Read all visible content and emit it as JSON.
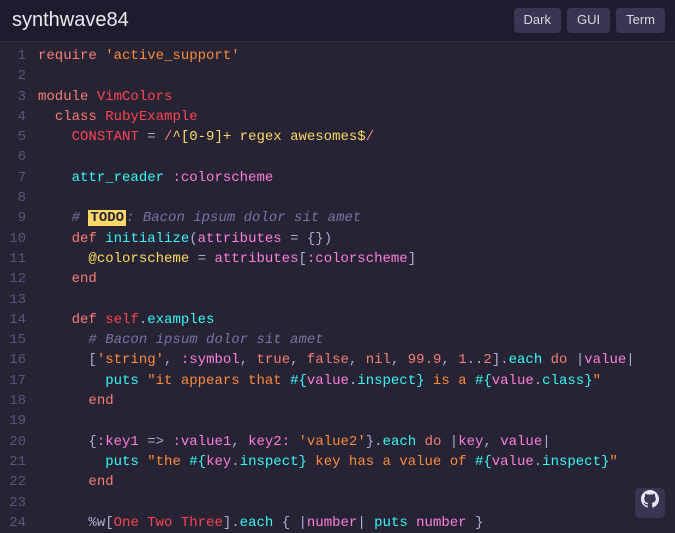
{
  "header": {
    "title": "synthwave84",
    "tabs": [
      "Dark",
      "GUI",
      "Term"
    ]
  },
  "icons": {
    "github": "github-icon"
  },
  "code": {
    "lines": [
      [
        [
          "keyword",
          "require"
        ],
        [
          "plain",
          " "
        ],
        [
          "string",
          "'active_support'"
        ]
      ],
      [],
      [
        [
          "keyword",
          "module"
        ],
        [
          "plain",
          " "
        ],
        [
          "const",
          "VimColors"
        ]
      ],
      [
        [
          "plain",
          "  "
        ],
        [
          "keyword",
          "class"
        ],
        [
          "plain",
          " "
        ],
        [
          "const",
          "RubyExample"
        ]
      ],
      [
        [
          "plain",
          "    "
        ],
        [
          "const",
          "CONSTANT"
        ],
        [
          "plain",
          " "
        ],
        [
          "op",
          "="
        ],
        [
          "plain",
          " "
        ],
        [
          "regex",
          "/"
        ],
        [
          "regexbody",
          "^[0-9]+ regex awesomes$"
        ],
        [
          "regex",
          "/"
        ]
      ],
      [],
      [
        [
          "plain",
          "    "
        ],
        [
          "ident",
          "attr_reader"
        ],
        [
          "plain",
          " "
        ],
        [
          "sym",
          ":colorscheme"
        ]
      ],
      [],
      [
        [
          "plain",
          "    "
        ],
        [
          "comment",
          "# "
        ],
        [
          "todo",
          "TODO"
        ],
        [
          "comment",
          ": Bacon ipsum dolor sit amet"
        ]
      ],
      [
        [
          "plain",
          "    "
        ],
        [
          "keyword",
          "def"
        ],
        [
          "plain",
          " "
        ],
        [
          "ident",
          "initialize"
        ],
        [
          "punc",
          "("
        ],
        [
          "var",
          "attributes"
        ],
        [
          "plain",
          " "
        ],
        [
          "op",
          "="
        ],
        [
          "plain",
          " "
        ],
        [
          "punc",
          "{})"
        ]
      ],
      [
        [
          "plain",
          "      "
        ],
        [
          "ivar",
          "@colorscheme"
        ],
        [
          "plain",
          " "
        ],
        [
          "op",
          "="
        ],
        [
          "plain",
          " "
        ],
        [
          "var",
          "attributes"
        ],
        [
          "punc",
          "["
        ],
        [
          "sym",
          ":colorscheme"
        ],
        [
          "punc",
          "]"
        ]
      ],
      [
        [
          "plain",
          "    "
        ],
        [
          "keyword",
          "end"
        ]
      ],
      [],
      [
        [
          "plain",
          "    "
        ],
        [
          "keyword",
          "def"
        ],
        [
          "plain",
          " "
        ],
        [
          "self",
          "self"
        ],
        [
          "punc",
          "."
        ],
        [
          "ident",
          "examples"
        ]
      ],
      [
        [
          "plain",
          "      "
        ],
        [
          "comment",
          "# Bacon ipsum dolor sit amet"
        ]
      ],
      [
        [
          "plain",
          "      "
        ],
        [
          "punc",
          "["
        ],
        [
          "string",
          "'string'"
        ],
        [
          "punc",
          ", "
        ],
        [
          "sym",
          ":symbol"
        ],
        [
          "punc",
          ", "
        ],
        [
          "bool",
          "true"
        ],
        [
          "punc",
          ", "
        ],
        [
          "bool",
          "false"
        ],
        [
          "punc",
          ", "
        ],
        [
          "nil",
          "nil"
        ],
        [
          "punc",
          ", "
        ],
        [
          "num",
          "99.9"
        ],
        [
          "punc",
          ", "
        ],
        [
          "num",
          "1"
        ],
        [
          "op",
          ".."
        ],
        [
          "num",
          "2"
        ],
        [
          "punc",
          "]."
        ],
        [
          "ident",
          "each"
        ],
        [
          "plain",
          " "
        ],
        [
          "keyword",
          "do"
        ],
        [
          "plain",
          " "
        ],
        [
          "op",
          "|"
        ],
        [
          "var",
          "value"
        ],
        [
          "op",
          "|"
        ]
      ],
      [
        [
          "plain",
          "        "
        ],
        [
          "ident",
          "puts"
        ],
        [
          "plain",
          " "
        ],
        [
          "string",
          "\"it appears that "
        ],
        [
          "interp",
          "#{"
        ],
        [
          "var",
          "value"
        ],
        [
          "punc",
          "."
        ],
        [
          "ident",
          "inspect"
        ],
        [
          "interp",
          "}"
        ],
        [
          "string",
          " is a "
        ],
        [
          "interp",
          "#{"
        ],
        [
          "var",
          "value"
        ],
        [
          "punc",
          "."
        ],
        [
          "ident",
          "class"
        ],
        [
          "interp",
          "}"
        ],
        [
          "string",
          "\""
        ]
      ],
      [
        [
          "plain",
          "      "
        ],
        [
          "keyword",
          "end"
        ]
      ],
      [],
      [
        [
          "plain",
          "      "
        ],
        [
          "punc",
          "{"
        ],
        [
          "sym",
          ":key1"
        ],
        [
          "plain",
          " "
        ],
        [
          "op",
          "=>"
        ],
        [
          "plain",
          " "
        ],
        [
          "sym",
          ":value1"
        ],
        [
          "punc",
          ", "
        ],
        [
          "sym",
          "key2:"
        ],
        [
          "plain",
          " "
        ],
        [
          "string",
          "'value2'"
        ],
        [
          "punc",
          "}."
        ],
        [
          "ident",
          "each"
        ],
        [
          "plain",
          " "
        ],
        [
          "keyword",
          "do"
        ],
        [
          "plain",
          " "
        ],
        [
          "op",
          "|"
        ],
        [
          "var",
          "key"
        ],
        [
          "punc",
          ", "
        ],
        [
          "var",
          "value"
        ],
        [
          "op",
          "|"
        ]
      ],
      [
        [
          "plain",
          "        "
        ],
        [
          "ident",
          "puts"
        ],
        [
          "plain",
          " "
        ],
        [
          "string",
          "\"the "
        ],
        [
          "interp",
          "#{"
        ],
        [
          "var",
          "key"
        ],
        [
          "punc",
          "."
        ],
        [
          "ident",
          "inspect"
        ],
        [
          "interp",
          "}"
        ],
        [
          "string",
          " key has a value of "
        ],
        [
          "interp",
          "#{"
        ],
        [
          "var",
          "value"
        ],
        [
          "punc",
          "."
        ],
        [
          "ident",
          "inspect"
        ],
        [
          "interp",
          "}"
        ],
        [
          "string",
          "\""
        ]
      ],
      [
        [
          "plain",
          "      "
        ],
        [
          "keyword",
          "end"
        ]
      ],
      [],
      [
        [
          "plain",
          "      "
        ],
        [
          "op",
          "%w"
        ],
        [
          "punc",
          "["
        ],
        [
          "const",
          "One Two Three"
        ],
        [
          "punc",
          "]."
        ],
        [
          "ident",
          "each"
        ],
        [
          "plain",
          " "
        ],
        [
          "punc",
          "{ "
        ],
        [
          "op",
          "|"
        ],
        [
          "var",
          "number"
        ],
        [
          "op",
          "|"
        ],
        [
          "plain",
          " "
        ],
        [
          "ident",
          "puts"
        ],
        [
          "plain",
          " "
        ],
        [
          "var",
          "number"
        ],
        [
          "plain",
          " "
        ],
        [
          "punc",
          "}"
        ]
      ]
    ]
  }
}
